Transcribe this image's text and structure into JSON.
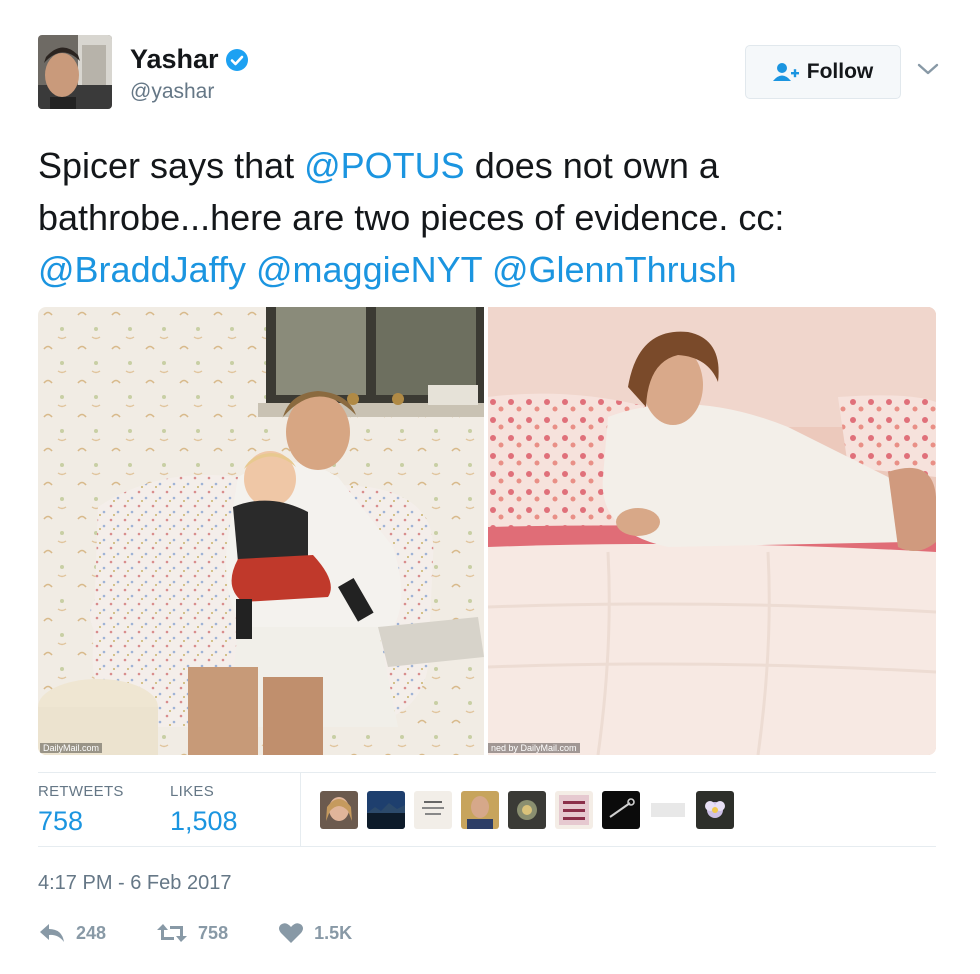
{
  "header": {
    "display_name": "Yashar",
    "handle": "@yashar",
    "follow_label": "Follow",
    "icons": {
      "verified": "verified-badge-icon",
      "follow": "add-user-icon",
      "menu": "chevron-down-icon"
    }
  },
  "tweet": {
    "segments": [
      {
        "text": "Spicer says that ",
        "type": "text"
      },
      {
        "text": "@POTUS",
        "type": "mention"
      },
      {
        "text": " does not own a bathrobe...here are two pieces of evidence. cc: ",
        "type": "text"
      },
      {
        "text": "@BraddJaffy",
        "type": "mention"
      },
      {
        "text": " ",
        "type": "text"
      },
      {
        "text": "@maggieNYT",
        "type": "mention"
      },
      {
        "text": " ",
        "type": "text"
      },
      {
        "text": "@GlennThrush",
        "type": "mention"
      }
    ]
  },
  "media": {
    "left_watermark": "DailyMail.com",
    "right_watermark": "ned by DailyMail.com"
  },
  "stats": {
    "retweets_label": "RETWEETS",
    "retweets_value": "758",
    "likes_label": "LIKES",
    "likes_value": "1,508"
  },
  "timestamp": "4:17 PM - 6 Feb 2017",
  "actions": {
    "reply_count": "248",
    "retweet_count": "758",
    "like_count": "1.5K",
    "icons": {
      "reply": "reply-icon",
      "retweet": "retweet-icon",
      "like": "heart-icon"
    }
  },
  "colors": {
    "accent": "#1b95e0",
    "muted": "#657786",
    "action_gray": "#8899a6",
    "verified": "#1da1f2"
  }
}
